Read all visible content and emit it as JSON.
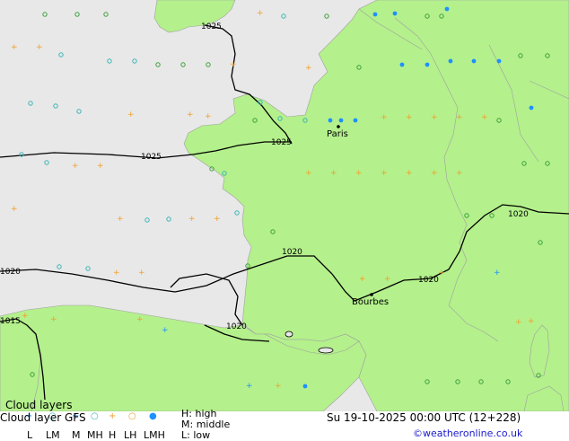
{
  "title_overlay": "Cloud layers",
  "footer": {
    "title": "Cloud layer GFS",
    "datetime": "Su 19-10-2025 00:00 UTC (12+228)",
    "credit": "©weatheronline.co.uk",
    "legend_symbols": [
      "L",
      "LM",
      "M",
      "MH",
      "H",
      "LH",
      "LMH"
    ],
    "legend_text": [
      "H: high",
      "M: middle",
      "L: low"
    ]
  },
  "map": {
    "cities": [
      "Paris",
      "Bourbes"
    ],
    "isobar_labels": [
      "1025",
      "1025",
      "1025",
      "1020",
      "1020",
      "1020",
      "1020",
      "1020",
      "1015"
    ]
  },
  "colors": {
    "land": "#b4f08c",
    "sea": "#e8e8e8",
    "low_cloud": "#3ca03c",
    "middle_cloud": "#3cb4b4",
    "high_cloud": "#f0a028",
    "high_cloud_dark": "#1e90ff"
  }
}
